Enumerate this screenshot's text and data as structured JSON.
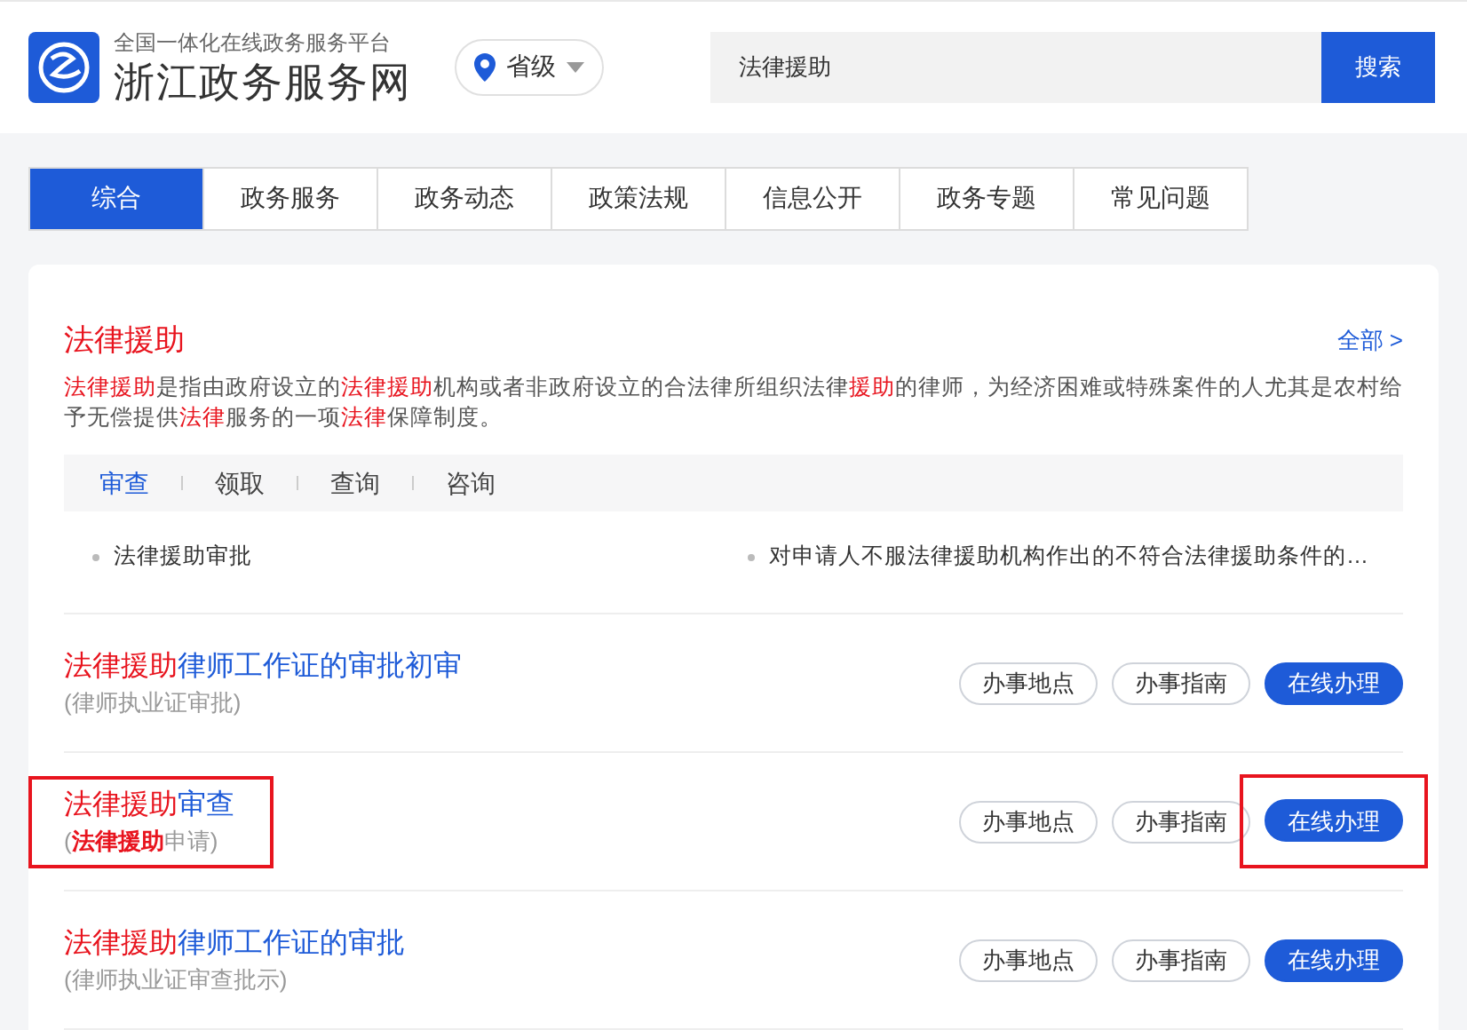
{
  "header": {
    "tagline": "全国一体化在线政务服务平台",
    "site_name": "浙江政务服务网",
    "region": "省级",
    "search": {
      "value": "法律援助",
      "button": "搜索"
    }
  },
  "tabs": [
    {
      "label": "综合",
      "selected": true
    },
    {
      "label": "政务服务",
      "selected": false
    },
    {
      "label": "政务动态",
      "selected": false
    },
    {
      "label": "政策法规",
      "selected": false
    },
    {
      "label": "信息公开",
      "selected": false
    },
    {
      "label": "政务专题",
      "selected": false
    },
    {
      "label": "常见问题",
      "selected": false
    }
  ],
  "topic": {
    "title": "法律援助",
    "more": "全部 >",
    "description": [
      {
        "text": "法律援助",
        "hit": true
      },
      {
        "text": "是指由政府设立的",
        "hit": false
      },
      {
        "text": "法律援助",
        "hit": true
      },
      {
        "text": "机构或者非政府设立的合法律所组织法律",
        "hit": false
      },
      {
        "text": "援助",
        "hit": true
      },
      {
        "text": "的律师，为经济困难或特殊案件的人尤其是农村给予无偿提供",
        "hit": false
      },
      {
        "text": "法律",
        "hit": true
      },
      {
        "text": "服务的一项",
        "hit": false
      },
      {
        "text": "法律",
        "hit": true
      },
      {
        "text": "保障制度。",
        "hit": false
      }
    ],
    "sub_tabs": [
      {
        "label": "审查",
        "selected": true
      },
      {
        "label": "领取",
        "selected": false
      },
      {
        "label": "查询",
        "selected": false
      },
      {
        "label": "咨询",
        "selected": false
      }
    ],
    "items": [
      "法律援助审批",
      "对申请人不服法律援助机构作出的不符合法律援助条件的…"
    ]
  },
  "results": [
    {
      "title": [
        {
          "text": "法律援助",
          "hit": true
        },
        {
          "text": "律师工作证的审批初审",
          "hit": false
        }
      ],
      "subtitle": [
        {
          "text": "(律师执业证审批)",
          "hit": false
        }
      ],
      "title_marked": false,
      "buttons": [
        {
          "label": "办事地点",
          "kind": "outline",
          "marked": false
        },
        {
          "label": "办事指南",
          "kind": "outline",
          "marked": false
        },
        {
          "label": "在线办理",
          "kind": "primary",
          "marked": false
        }
      ]
    },
    {
      "title": [
        {
          "text": "法律援助",
          "hit": true
        },
        {
          "text": "审查",
          "hit": false
        }
      ],
      "subtitle": [
        {
          "text": "(",
          "hit": false
        },
        {
          "text": "法律援助",
          "hit": true
        },
        {
          "text": "申请)",
          "hit": false
        }
      ],
      "title_marked": true,
      "buttons": [
        {
          "label": "办事地点",
          "kind": "outline",
          "marked": false
        },
        {
          "label": "办事指南",
          "kind": "outline",
          "marked": false
        },
        {
          "label": "在线办理",
          "kind": "primary",
          "marked": true
        }
      ]
    },
    {
      "title": [
        {
          "text": "法律援助",
          "hit": true
        },
        {
          "text": "律师工作证的审批",
          "hit": false
        }
      ],
      "subtitle": [
        {
          "text": "(律师执业证审查批示)",
          "hit": false
        }
      ],
      "title_marked": false,
      "buttons": [
        {
          "label": "办事地点",
          "kind": "outline",
          "marked": false
        },
        {
          "label": "办事指南",
          "kind": "outline",
          "marked": false
        },
        {
          "label": "在线办理",
          "kind": "primary",
          "marked": false
        }
      ]
    }
  ]
}
